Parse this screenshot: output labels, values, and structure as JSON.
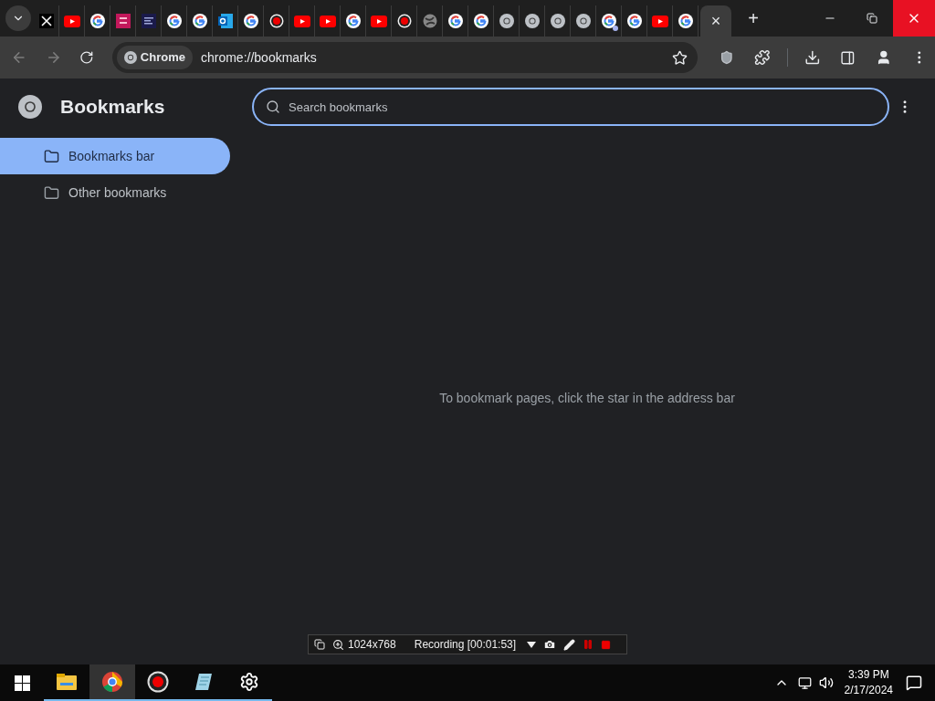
{
  "tabs": [
    {
      "kind": "x",
      "selected": false,
      "badge": false
    },
    {
      "kind": "youtube",
      "selected": false,
      "badge": false
    },
    {
      "kind": "google",
      "selected": false,
      "badge": false
    },
    {
      "kind": "app-pink",
      "selected": false,
      "badge": false
    },
    {
      "kind": "app-dark",
      "selected": false,
      "badge": false
    },
    {
      "kind": "google",
      "selected": false,
      "badge": false
    },
    {
      "kind": "google",
      "selected": false,
      "badge": false
    },
    {
      "kind": "outlook",
      "selected": false,
      "badge": false
    },
    {
      "kind": "google",
      "selected": false,
      "badge": false
    },
    {
      "kind": "record",
      "selected": false,
      "badge": false
    },
    {
      "kind": "youtube",
      "selected": false,
      "badge": false
    },
    {
      "kind": "youtube",
      "selected": false,
      "badge": false
    },
    {
      "kind": "google",
      "selected": false,
      "badge": false
    },
    {
      "kind": "youtube",
      "selected": false,
      "badge": false
    },
    {
      "kind": "record",
      "selected": false,
      "badge": false
    },
    {
      "kind": "globe",
      "selected": false,
      "badge": false
    },
    {
      "kind": "google",
      "selected": false,
      "badge": false
    },
    {
      "kind": "google",
      "selected": false,
      "badge": false
    },
    {
      "kind": "chrome",
      "selected": false,
      "badge": false
    },
    {
      "kind": "chrome",
      "selected": false,
      "badge": false
    },
    {
      "kind": "chrome",
      "selected": false,
      "badge": false
    },
    {
      "kind": "chrome",
      "selected": false,
      "badge": false
    },
    {
      "kind": "google",
      "selected": false,
      "badge": true
    },
    {
      "kind": "google",
      "selected": false,
      "badge": false
    },
    {
      "kind": "youtube",
      "selected": false,
      "badge": false
    },
    {
      "kind": "google",
      "selected": false,
      "badge": false
    },
    {
      "kind": "close",
      "selected": true,
      "badge": false,
      "close_label": "×"
    }
  ],
  "new_tab_label": "+",
  "address_bar": {
    "chip": "Chrome",
    "url": "chrome://bookmarks"
  },
  "sidebar": {
    "title": "Bookmarks",
    "items": [
      {
        "label": "Bookmarks bar",
        "selected": true
      },
      {
        "label": "Other bookmarks",
        "selected": false
      }
    ]
  },
  "search": {
    "placeholder": "Search bookmarks"
  },
  "empty_message": "To bookmark pages, click the star in the address bar",
  "recorder": {
    "resolution": "1024x768",
    "status": "Recording [00:01:53]"
  },
  "taskbar": {
    "apps": [
      {
        "kind": "explorer",
        "selected": false
      },
      {
        "kind": "chrome",
        "selected": true
      },
      {
        "kind": "record",
        "selected": false
      },
      {
        "kind": "notepad",
        "selected": false
      },
      {
        "kind": "settings",
        "selected": false
      }
    ],
    "time": "3:39 PM",
    "date": "2/17/2024"
  }
}
